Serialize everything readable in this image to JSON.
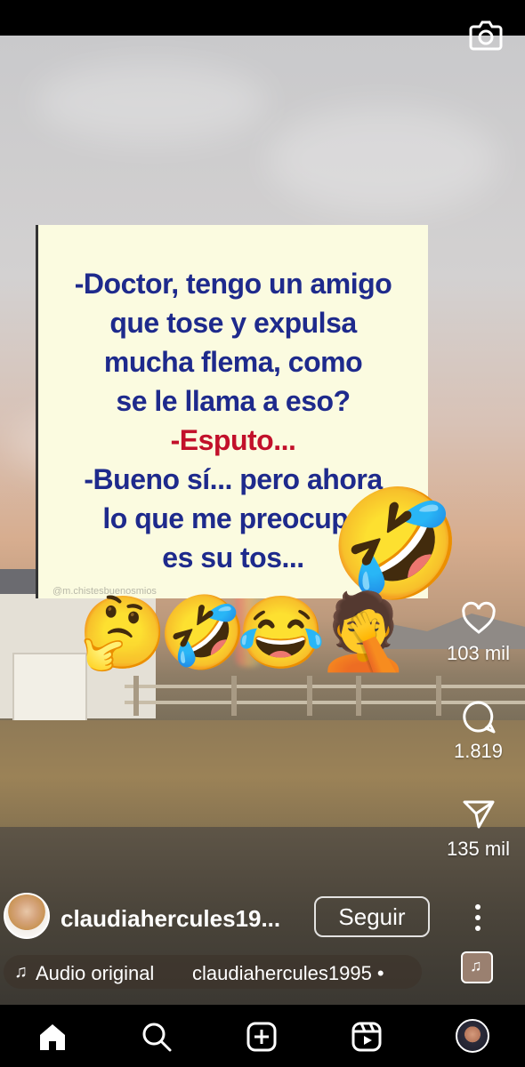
{
  "post": {
    "meme_lines": [
      "-Doctor, tengo un amigo",
      "que tose y expulsa",
      "mucha flema, como",
      "se le llama a eso?",
      "-Esputo...",
      "-Bueno sí... pero ahora",
      "lo que me preocupa",
      "es su tos..."
    ],
    "watermark": "@m.chistesbuenosmios",
    "reaction_emojis": [
      "🤣",
      "🤔",
      "🤣",
      "😂",
      "🤦"
    ]
  },
  "actions": {
    "like_count": "103 mil",
    "comment_count": "1.819",
    "share_count": "135 mil"
  },
  "author": {
    "username": "claudiahercules19...",
    "follow_label": "Seguir"
  },
  "audio": {
    "label": "Audio original",
    "artist": "claudiahercules1995 •"
  },
  "icons": {
    "camera": "camera-icon",
    "like": "heart-icon",
    "comment": "comment-bubble-icon",
    "share": "paper-plane-icon",
    "more": "more-vertical-icon",
    "music": "music-note-icon",
    "home": "home-icon",
    "search": "search-icon",
    "create": "plus-square-icon",
    "reels": "reels-icon"
  },
  "colors": {
    "meme_text": "#1e2a8c",
    "meme_highlight": "#c2102a",
    "meme_bg": "#fbfbe0"
  }
}
